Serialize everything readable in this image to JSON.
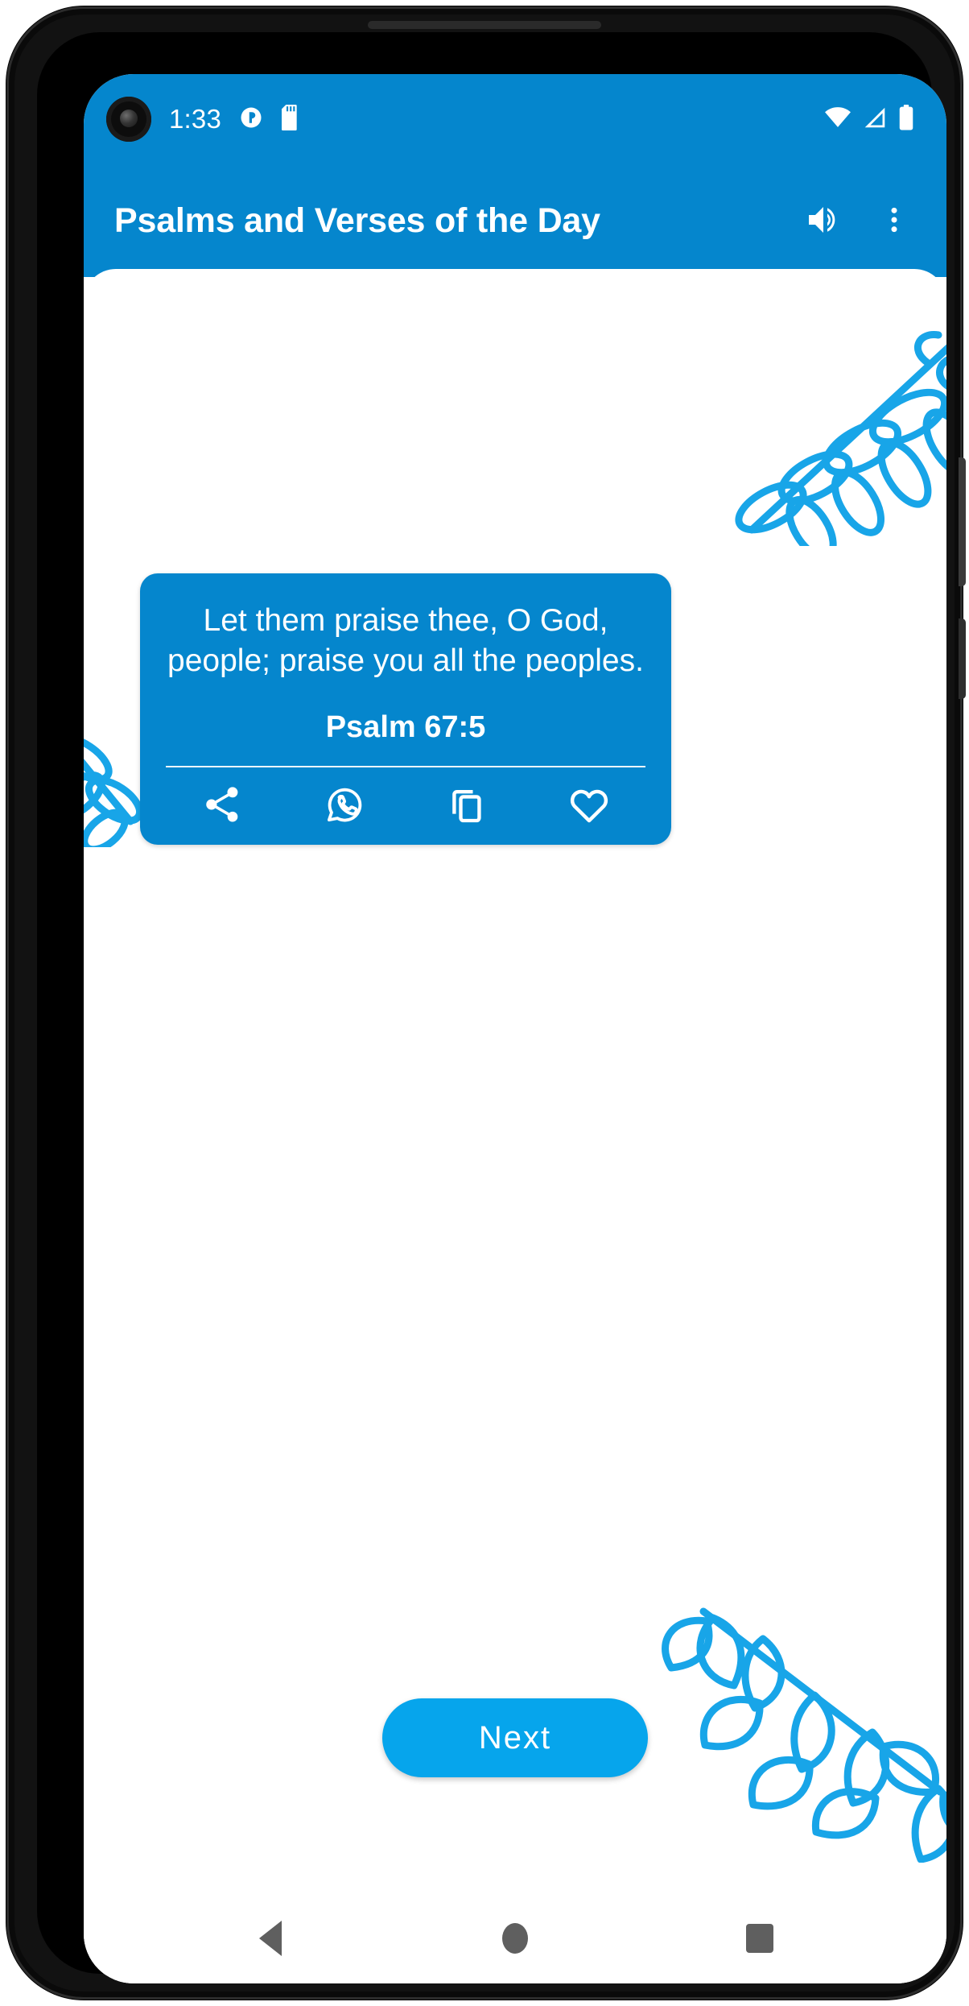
{
  "theme": {
    "brand": "#0586cd",
    "brand_light": "#06a5ec",
    "leaf": "#18a5e8",
    "nav_icon": "#5f5f5f",
    "screen_bg": "#ffffff"
  },
  "status_bar": {
    "time": "1:33",
    "left_icons": [
      "camera-punch-hole",
      "app-notification-icon",
      "sd-card-icon"
    ],
    "right_icons": [
      "wifi-icon",
      "cellular-signal-icon",
      "battery-icon"
    ]
  },
  "app_bar": {
    "title": "Psalms and Verses of the Day",
    "actions": [
      {
        "name": "volume-up-icon",
        "label": "Volume"
      },
      {
        "name": "overflow-menu-icon",
        "label": "More options"
      }
    ]
  },
  "decorations": [
    {
      "name": "leaf-branch-top-right"
    },
    {
      "name": "leaf-branch-left-small"
    },
    {
      "name": "leaf-branch-bottom-right"
    }
  ],
  "verse_card": {
    "text": "Let them praise thee, O God, people; praise you all the peoples.",
    "reference": "Psalm 67:5",
    "actions": [
      {
        "name": "share-icon",
        "label": "Share"
      },
      {
        "name": "whatsapp-icon",
        "label": "WhatsApp"
      },
      {
        "name": "copy-icon",
        "label": "Copy"
      },
      {
        "name": "favorite-heart-icon",
        "label": "Favorite"
      }
    ]
  },
  "next_button": {
    "label": "Next"
  },
  "nav_bar": {
    "buttons": [
      {
        "name": "nav-back-button",
        "label": "Back"
      },
      {
        "name": "nav-home-button",
        "label": "Home"
      },
      {
        "name": "nav-recents-button",
        "label": "Recents"
      }
    ]
  }
}
